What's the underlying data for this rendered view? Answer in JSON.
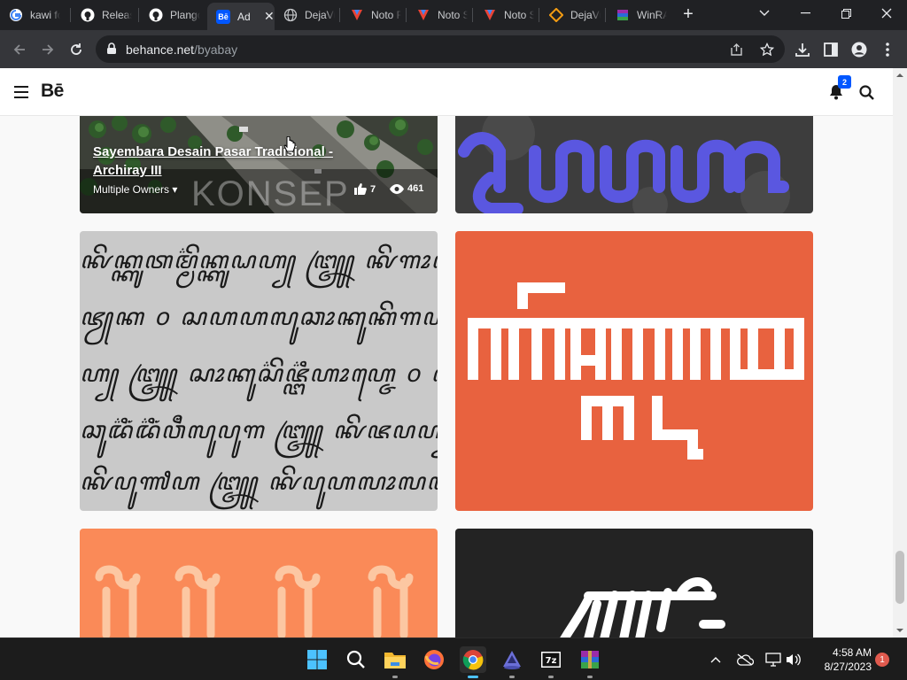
{
  "tabs": [
    {
      "label": "kawi fo",
      "icon": "google-icon"
    },
    {
      "label": "Releas",
      "icon": "github-icon"
    },
    {
      "label": "Plango",
      "icon": "github-icon"
    },
    {
      "label": "Ad",
      "icon": "behance-icon",
      "active": true
    },
    {
      "label": "DejaVu",
      "icon": "globe-icon"
    },
    {
      "label": "Noto F",
      "icon": "noto-icon"
    },
    {
      "label": "Noto S",
      "icon": "noto-icon"
    },
    {
      "label": "Noto S",
      "icon": "noto-icon"
    },
    {
      "label": "DejaVu",
      "icon": "dejavu-icon"
    },
    {
      "label": "WinRA",
      "icon": "winrar-icon"
    }
  ],
  "address_bar": {
    "domain": "behance.net",
    "path": "/byabay"
  },
  "site": {
    "logo": "Bē",
    "notification_count": "2"
  },
  "projects": {
    "featured": {
      "title": "Sayembara Desain Pasar Tradisional - Archiray III",
      "owners": "Multiple Owners",
      "likes": "7",
      "views": "461",
      "overlay_text": "KONSEP"
    },
    "script_specimen_lines": [
      "ꦑꦼꦏ꧀ꦏꦸꦠꦩ꧀ꦩ꦳ꦼꦏ꧀ꦏꦸꦝꦲ꧀ ꧅ ꦑꦼꦒꦴꦮꦮ",
      "ꦗꦾꦏ ꧆ ꦱꦲꦲꦭꦸꦕꦴꦏꦸꦏꦼꦒꦲꦴꦁ",
      "ꦲ꧀ ꧅ ꦱꦴꦏꦸꦱ꦳ꦼꦗ꧀ꦔ꦳ꦶꦲꦴꦲ꧀ꦗꦺ ꧆ ꦱꦲꦲ",
      "ꦕꦸꦢ꦳ꦶꦁꦢ꦳ꦶꦁꦮꦷꦭꦸꦥꦸꦒ ꧅ ꦑꦼꦗꦥꦲ꧀",
      "ꦑꦼꦥꦸꦬꦲ ꧅ ꦑꦼꦥꦸꦲꦭꦴꦭꦮꦱꦲꦑꦼꦢꦸ"
    ]
  },
  "colors": {
    "accent_blue": "#0057ff",
    "card_purple": "#5a57e0",
    "card_orange_red": "#e8623f",
    "card_salmon": "#fa8a58",
    "card_dark": "#232323"
  },
  "taskbar": {
    "time": "4:58 AM",
    "date": "8/27/2023",
    "notifications": "1",
    "apps": [
      "windows-start-icon",
      "search-icon",
      "file-explorer-icon",
      "firefox-icon",
      "chrome-icon",
      "inkscape-icon",
      "7zip-icon",
      "winrar-icon"
    ]
  }
}
